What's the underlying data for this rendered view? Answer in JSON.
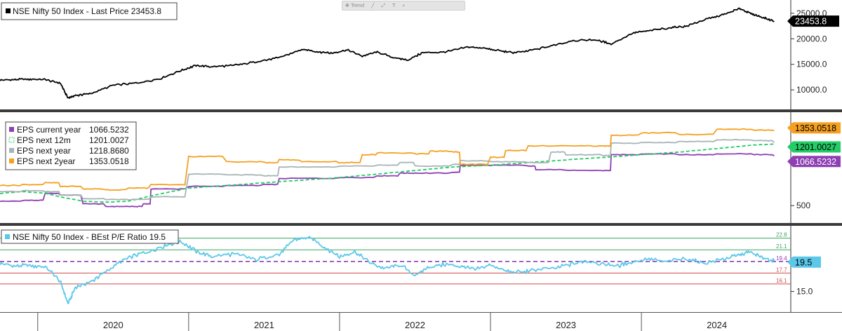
{
  "toolbar": {
    "items": [
      {
        "icon": "move-icon",
        "glyph": "✥",
        "label": "Trend"
      },
      {
        "icon": "line-icon",
        "glyph": "╱",
        "label": ""
      },
      {
        "icon": "expand-icon",
        "glyph": "⤢",
        "label": ""
      },
      {
        "icon": "text-icon",
        "glyph": "T",
        "label": ""
      },
      {
        "icon": "search-icon",
        "glyph": "⌕",
        "label": ""
      }
    ]
  },
  "chart_data": [
    {
      "type": "line",
      "panel": "price",
      "legend": [
        {
          "label": "NSE Nifty 50 Index - Last Price 23453.8",
          "color": "#000000"
        }
      ],
      "y_ticks": [
        "25000.0",
        "20000.0",
        "15000.0",
        "10000.0"
      ],
      "ylim": [
        7000,
        26500
      ],
      "last_value_tag": {
        "text": "23453.8",
        "bg": "#000000",
        "fg": "#ffffff"
      },
      "series": [
        {
          "name": "NSE Nifty 50 Index - Last Price",
          "color": "#000000",
          "x": [
            2019.75,
            2019.85,
            2019.95,
            2020.05,
            2020.15,
            2020.2,
            2020.25,
            2020.35,
            2020.5,
            2020.65,
            2020.8,
            2020.95,
            2021.05,
            2021.15,
            2021.3,
            2021.45,
            2021.6,
            2021.75,
            2021.85,
            2021.95,
            2022.05,
            2022.15,
            2022.25,
            2022.35,
            2022.45,
            2022.55,
            2022.7,
            2022.85,
            2022.95,
            2023.05,
            2023.15,
            2023.25,
            2023.4,
            2023.55,
            2023.7,
            2023.8,
            2023.95,
            2024.05,
            2024.2,
            2024.3,
            2024.45,
            2024.55,
            2024.65,
            2024.72,
            2024.8,
            2024.88
          ],
          "values": [
            11900,
            12000,
            12100,
            12000,
            11300,
            8400,
            8900,
            9300,
            10900,
            11300,
            12100,
            13800,
            14800,
            14500,
            14800,
            15500,
            16300,
            17900,
            17500,
            17200,
            17800,
            16600,
            17400,
            16400,
            15800,
            17300,
            17400,
            18400,
            18200,
            17700,
            17300,
            17600,
            18600,
            19700,
            19800,
            19000,
            21200,
            21600,
            22200,
            22500,
            24000,
            24800,
            25900,
            25000,
            24200,
            23453.8
          ]
        }
      ]
    },
    {
      "type": "line",
      "panel": "eps",
      "legend": [
        {
          "label": "EPS current year",
          "value": "1066.5232",
          "color": "#8e3fb4",
          "style": "solid"
        },
        {
          "label": "EPS next 12m",
          "value": "1201.0027",
          "color": "#22cc66",
          "style": "dashed"
        },
        {
          "label": "EPS next year",
          "value": "1218.8680",
          "color": "#a7b4b6",
          "style": "solid"
        },
        {
          "label": "EPS next 2year",
          "value": "1353.0518",
          "color": "#f5a020",
          "style": "solid"
        }
      ],
      "y_ticks": [
        "1000",
        "500"
      ],
      "ylim": [
        350,
        1500
      ],
      "series": [
        {
          "name": "EPS current year",
          "color": "#8e3fb4",
          "dashed": false,
          "x": [
            2019.75,
            2019.9,
            2020.05,
            2020.15,
            2020.3,
            2020.45,
            2020.6,
            2020.7,
            2020.75,
            2021.0,
            2021.25,
            2021.5,
            2021.6,
            2022.0,
            2022.25,
            2022.4,
            2022.5,
            2022.75,
            2022.8,
            2023.0,
            2023.25,
            2023.3,
            2023.5,
            2023.75,
            2023.8,
            2024.0,
            2024.25,
            2024.5,
            2024.75,
            2024.88
          ],
          "values": [
            550,
            560,
            640,
            620,
            520,
            490,
            490,
            520,
            690,
            720,
            730,
            740,
            810,
            820,
            840,
            870,
            870,
            880,
            960,
            960,
            950,
            910,
            900,
            900,
            1080,
            1090,
            1080,
            1090,
            1080,
            1066.5232
          ]
        },
        {
          "name": "EPS next 12m",
          "color": "#22cc66",
          "dashed": true,
          "x": [
            2019.75,
            2019.9,
            2020.05,
            2020.15,
            2020.3,
            2020.45,
            2020.6,
            2020.75,
            2021.0,
            2021.25,
            2021.5,
            2021.75,
            2022.0,
            2022.25,
            2022.5,
            2022.75,
            2023.0,
            2023.25,
            2023.5,
            2023.75,
            2024.0,
            2024.25,
            2024.5,
            2024.75,
            2024.88
          ],
          "values": [
            640,
            660,
            640,
            600,
            550,
            540,
            550,
            610,
            700,
            730,
            760,
            790,
            820,
            860,
            900,
            940,
            960,
            990,
            1020,
            1050,
            1080,
            1110,
            1150,
            1190,
            1201.0027
          ]
        },
        {
          "name": "EPS next year",
          "color": "#a7b4b6",
          "dashed": false,
          "x": [
            2019.75,
            2019.9,
            2020.05,
            2020.15,
            2020.3,
            2020.45,
            2020.6,
            2020.75,
            2021.0,
            2021.25,
            2021.5,
            2021.6,
            2022.0,
            2022.25,
            2022.4,
            2022.5,
            2022.75,
            2022.8,
            2023.0,
            2023.25,
            2023.4,
            2023.5,
            2023.75,
            2023.8,
            2024.0,
            2024.25,
            2024.5,
            2024.75,
            2024.88
          ],
          "values": [
            660,
            670,
            660,
            620,
            580,
            570,
            570,
            600,
            860,
            850,
            840,
            940,
            950,
            960,
            990,
            950,
            970,
            1010,
            1000,
            990,
            1110,
            1080,
            1070,
            1210,
            1220,
            1230,
            1250,
            1240,
            1218.868
          ]
        },
        {
          "name": "EPS next 2year",
          "color": "#f5a020",
          "dashed": false,
          "x": [
            2019.75,
            2019.9,
            2020.05,
            2020.15,
            2020.3,
            2020.45,
            2020.6,
            2020.75,
            2021.0,
            2021.25,
            2021.5,
            2021.6,
            2021.75,
            2022.0,
            2022.15,
            2022.25,
            2022.5,
            2022.6,
            2022.75,
            2022.8,
            2023.0,
            2023.1,
            2023.25,
            2023.5,
            2023.75,
            2023.8,
            2024.0,
            2024.25,
            2024.5,
            2024.75,
            2024.88
          ],
          "values": [
            730,
            740,
            760,
            720,
            690,
            680,
            700,
            740,
            1060,
            1000,
            990,
            1020,
            1000,
            990,
            1080,
            1100,
            1090,
            1120,
            1110,
            970,
            1050,
            1130,
            1180,
            1180,
            1180,
            1300,
            1330,
            1310,
            1370,
            1360,
            1353.0518
          ]
        }
      ]
    },
    {
      "type": "line",
      "panel": "pe",
      "legend": [
        {
          "label": "NSE Nifty 50 Index - BEst P/E Ratio 19.5",
          "color": "#5bc8ea"
        }
      ],
      "y_ticks": [
        "15.0"
      ],
      "ylim": [
        12.5,
        24.2
      ],
      "last_value_tag": {
        "text": "19.5",
        "bg": "#5bc8ea",
        "fg": "#000000"
      },
      "reference_lines": [
        {
          "value": 22.8,
          "label": "22.8",
          "color": "#3aa55e",
          "style": "solid"
        },
        {
          "value": 21.1,
          "label": "21.1",
          "color": "#3aa55e",
          "style": "solid"
        },
        {
          "value": 19.4,
          "label": "19.4",
          "color": "#8e3fb4",
          "style": "dashed"
        },
        {
          "value": 17.7,
          "label": "17.7",
          "color": "#d04a4a",
          "style": "solid"
        },
        {
          "value": 16.1,
          "label": "16.1",
          "color": "#d04a4a",
          "style": "solid"
        }
      ],
      "series": [
        {
          "name": "NSE Nifty 50 Index - BEst P/E Ratio",
          "color": "#5bc8ea",
          "x": [
            2019.75,
            2019.85,
            2019.95,
            2020.05,
            2020.15,
            2020.2,
            2020.25,
            2020.35,
            2020.45,
            2020.55,
            2020.65,
            2020.75,
            2020.85,
            2020.95,
            2021.05,
            2021.15,
            2021.3,
            2021.45,
            2021.6,
            2021.7,
            2021.8,
            2021.9,
            2022.0,
            2022.1,
            2022.2,
            2022.3,
            2022.4,
            2022.5,
            2022.6,
            2022.7,
            2022.8,
            2022.9,
            2023.0,
            2023.1,
            2023.2,
            2023.3,
            2023.45,
            2023.55,
            2023.65,
            2023.75,
            2023.85,
            2023.95,
            2024.05,
            2024.15,
            2024.3,
            2024.4,
            2024.55,
            2024.65,
            2024.72,
            2024.8,
            2024.88
          ],
          "values": [
            19.1,
            18.7,
            18.8,
            18.6,
            16.5,
            13.2,
            15.6,
            16.4,
            17.9,
            19.4,
            20.3,
            20.9,
            21.8,
            22.3,
            20.9,
            20.1,
            20.5,
            19.7,
            20.4,
            22.6,
            22.9,
            21.5,
            20.1,
            20.8,
            19.2,
            18.3,
            18.9,
            17.4,
            18.6,
            19.0,
            18.7,
            18.2,
            18.9,
            18.0,
            17.8,
            18.2,
            18.5,
            19.1,
            19.5,
            19.0,
            18.8,
            19.4,
            19.8,
            19.4,
            19.8,
            19.2,
            19.7,
            20.4,
            20.8,
            19.9,
            19.5
          ]
        }
      ]
    }
  ],
  "x_axis": {
    "labels": [
      {
        "text": "2020",
        "at": 2020.5
      },
      {
        "text": "2021",
        "at": 2021.5
      },
      {
        "text": "2022",
        "at": 2022.5
      },
      {
        "text": "2023",
        "at": 2023.5
      },
      {
        "text": "2024",
        "at": 2024.5
      }
    ],
    "year_boundaries": [
      2020.0,
      2021.0,
      2022.0,
      2023.0,
      2024.0,
      2025.0
    ],
    "xlim": [
      2019.75,
      2024.92
    ]
  },
  "colors": {
    "background": "#ffffff",
    "separator": "#3a3a3a",
    "axis": "#333333"
  }
}
